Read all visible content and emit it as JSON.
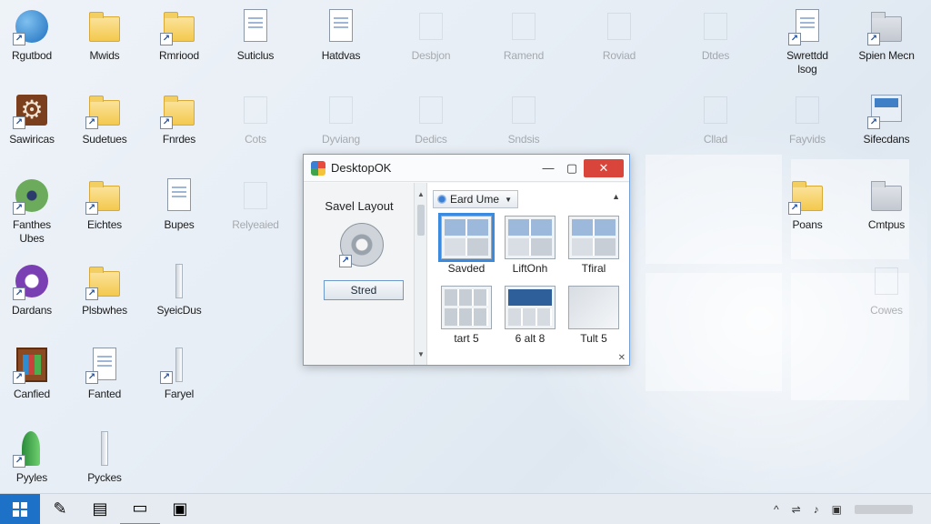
{
  "desktop": {
    "icons": [
      {
        "label": "Rgutbod",
        "glyph": "globe-icon",
        "shortcut": true
      },
      {
        "label": "Mwids",
        "glyph": "folder-icon",
        "shortcut": false
      },
      {
        "label": "Rmriood",
        "glyph": "folder-icon",
        "shortcut": true
      },
      {
        "label": "Suticlus",
        "glyph": "document-icon",
        "shortcut": false
      },
      {
        "label": "Hatdvas",
        "glyph": "document-icon",
        "shortcut": false
      },
      {
        "label": "Desbjon",
        "glyph": "faint-icon",
        "shortcut": false
      },
      {
        "label": "Ramend",
        "glyph": "faint-icon",
        "shortcut": false
      },
      {
        "label": "Roviad",
        "glyph": "faint-icon",
        "shortcut": false
      },
      {
        "label": "Dtdes",
        "glyph": "faint-icon",
        "shortcut": false
      },
      {
        "label": "Swrettdd\nlsog",
        "glyph": "document-icon",
        "shortcut": true
      },
      {
        "label": "Spien Mecn",
        "glyph": "gray-folder-icon",
        "shortcut": true
      },
      {
        "label": "Sawiricas",
        "glyph": "gear-icon",
        "shortcut": true
      },
      {
        "label": "Sudetues",
        "glyph": "folder-icon",
        "shortcut": true
      },
      {
        "label": "Fnrdes",
        "glyph": "folder-icon",
        "shortcut": true
      },
      {
        "label": "Cots",
        "glyph": "faint-icon",
        "shortcut": false
      },
      {
        "label": "Dyviang",
        "glyph": "faint-icon",
        "shortcut": false
      },
      {
        "label": "Dedics",
        "glyph": "faint-icon",
        "shortcut": false
      },
      {
        "label": "Sndsis",
        "glyph": "faint-icon",
        "shortcut": false
      },
      {
        "label": "Cllad",
        "glyph": "faint-icon",
        "shortcut": false
      },
      {
        "label": "Fayvids",
        "glyph": "faint-icon",
        "shortcut": false
      },
      {
        "label": "Sifecdans",
        "glyph": "monitor-icon",
        "shortcut": true
      },
      {
        "label": "Fanthes\nUbes",
        "glyph": "disc-icon",
        "shortcut": true
      },
      {
        "label": "Eichtes",
        "glyph": "folder-icon",
        "shortcut": true
      },
      {
        "label": "Bupes",
        "glyph": "document-icon",
        "shortcut": false
      },
      {
        "label": "Relyeaied",
        "glyph": "faint-icon",
        "shortcut": false
      },
      {
        "label": "Poans",
        "glyph": "folder-icon",
        "shortcut": true
      },
      {
        "label": "Cmtpus",
        "glyph": "gray-folder-icon",
        "shortcut": false
      },
      {
        "label": "Dardans",
        "glyph": "purple-icon",
        "shortcut": true
      },
      {
        "label": "Plsbwhes",
        "glyph": "folder-icon",
        "shortcut": true
      },
      {
        "label": "SyeicDus",
        "glyph": "bar-icon",
        "shortcut": false
      },
      {
        "label": "Cowes",
        "glyph": "faint-icon",
        "shortcut": false
      },
      {
        "label": "Canfied",
        "glyph": "frame-icon",
        "shortcut": true
      },
      {
        "label": "Fanted",
        "glyph": "document-icon",
        "shortcut": true
      },
      {
        "label": "Faryel",
        "glyph": "bar-icon",
        "shortcut": true
      },
      {
        "label": "Pyyles",
        "glyph": "rocket-icon",
        "shortcut": true
      },
      {
        "label": "Pyckes",
        "glyph": "bar-icon",
        "shortcut": false
      }
    ],
    "shortcut_glyph": "↗"
  },
  "window": {
    "title": "DesktopOK",
    "minimize": "—",
    "maximize": "▢",
    "close": "✕",
    "saved_layout_title": "Savel Layout",
    "restore_button": "Stred",
    "dropdown_label": "Eard Ume",
    "dropdown_arrow": "▼",
    "collapse_glyph": "▲",
    "scroll_up": "▲",
    "scroll_down": "▼",
    "resize_glyph": "✕",
    "layouts": [
      {
        "label": "Savded",
        "style": "split",
        "selected": true
      },
      {
        "label": "LiftOnh",
        "style": "split",
        "selected": false
      },
      {
        "label": "Tfiral",
        "style": "split",
        "selected": false
      },
      {
        "label": "tart 5",
        "style": "grid",
        "selected": false
      },
      {
        "label": "6 alt 8",
        "style": "dark",
        "selected": false
      },
      {
        "label": "Tult 5",
        "style": "plain",
        "selected": false
      }
    ]
  },
  "taskbar": {
    "apps": [
      {
        "glyph": "✎",
        "name": "pen-icon",
        "active": false
      },
      {
        "glyph": "▤",
        "name": "document-app-icon",
        "active": false
      },
      {
        "glyph": "▭",
        "name": "file-explorer-icon",
        "active": true
      },
      {
        "glyph": "▣",
        "name": "store-icon",
        "active": false
      }
    ],
    "tray": [
      {
        "glyph": "^",
        "name": "tray-chevron-icon"
      },
      {
        "glyph": "⇌",
        "name": "network-icon"
      },
      {
        "glyph": "♪",
        "name": "volume-icon"
      },
      {
        "glyph": "▣",
        "name": "action-center-icon"
      }
    ]
  }
}
